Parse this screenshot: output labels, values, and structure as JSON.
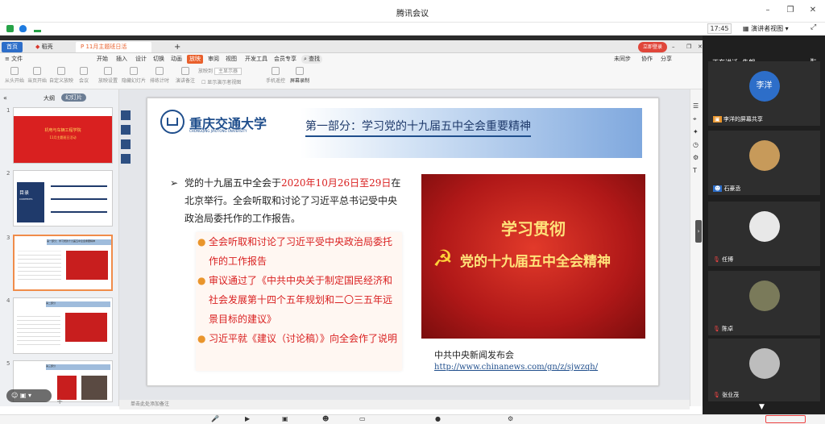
{
  "window": {
    "title": "腾讯会议",
    "time": "17:45",
    "view_mode": "演讲者视图"
  },
  "wps": {
    "tabs": [
      "首页",
      "稻壳",
      "11月主题班日活动.pptx"
    ],
    "account_badge": "立即登录",
    "menu": [
      "文件",
      "开始",
      "插入",
      "设计",
      "切换",
      "动画",
      "放映",
      "审阅",
      "视图",
      "开发工具",
      "会员专享",
      "查找"
    ],
    "menu_right": [
      "未同步",
      "协作",
      "分享"
    ],
    "tools": [
      "从头开始",
      "当页开始",
      "自定义放映",
      "会议",
      "放映设置",
      "隐藏幻灯片",
      "排练计时",
      "演讲备注",
      "放映到",
      "主显示器",
      "显示演示者视图",
      "手机遥控",
      "屏幕录制"
    ],
    "left_tabs": [
      "大纲",
      "幻灯片"
    ],
    "notes_placeholder": "单击此处添加备注"
  },
  "thumbnails": [
    {
      "num": "1",
      "title": "机电与车辆工程学院",
      "subtitle": "11月主题班日活动"
    },
    {
      "num": "2",
      "title": "目录",
      "subtitle": "CONTENTS"
    },
    {
      "num": "3",
      "title": "第一部分：学习党的十九届五中全会重要精神",
      "subtitle": ""
    },
    {
      "num": "4",
      "title": "第二部分",
      "subtitle": ""
    },
    {
      "num": "5",
      "title": "第三部分",
      "subtitle": ""
    }
  ],
  "slide": {
    "university_cn": "重庆交通大学",
    "university_en": "CHONGQING JIAOTONG UNIVERSITY",
    "heading": "第一部分：学习党的十九届五中全会重要精神",
    "intro_a": "党的十九届五中全会于",
    "intro_date": "2020年10月26日至29日",
    "intro_b": "在北京举行。全会听取和讨论了习近平总书记受中央政治局委托作的工作报告。",
    "bullets": [
      "全会听取和讨论了习近平受中央政治局委托作的工作报告",
      "审议通过了《中共中央关于制定国民经济和社会发展第十四个五年规划和二〇三五年远景目标的建议》",
      "习近平就《建议（讨论稿）》向全会作了说明"
    ],
    "banner_line1": "学习贯彻",
    "banner_line2": "党的十九届五中全会精神",
    "source": "中共中央新闻发布会",
    "link": "http://www.chinanews.com/gn/z/sjwzqh/"
  },
  "panel": {
    "speaking_label": "正在讲话: 朱朗;",
    "participants": [
      {
        "name": "李洋的屏幕共享",
        "avatar_text": "李洋"
      },
      {
        "name": "石豪丞",
        "avatar_text": ""
      },
      {
        "name": "任博",
        "avatar_text": ""
      },
      {
        "name": "陈卓",
        "avatar_text": ""
      },
      {
        "name": "张业茂",
        "avatar_text": ""
      }
    ]
  },
  "colors": {
    "accent": "#2d6ec9",
    "slide_red": "#c81e1e",
    "wps_orange": "#e9602c"
  }
}
